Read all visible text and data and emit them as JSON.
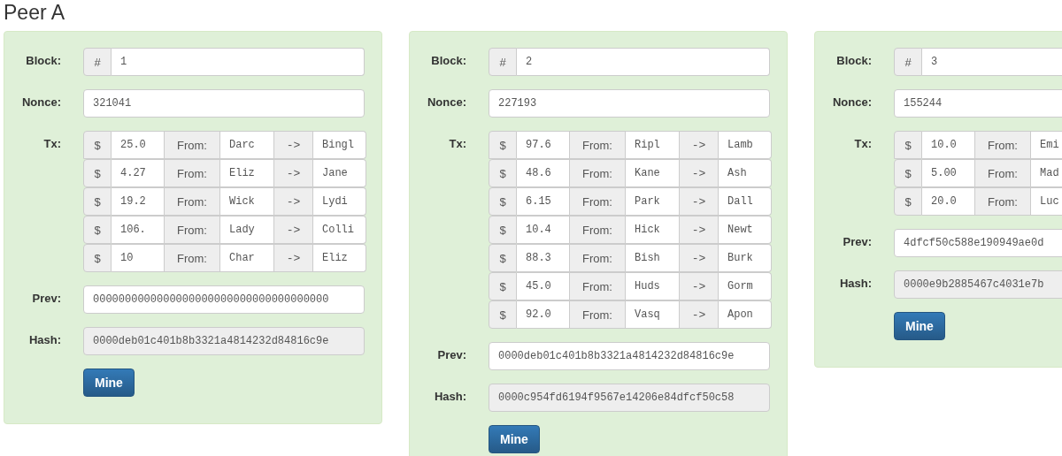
{
  "peer": {
    "title": "Peer A"
  },
  "blocks": [
    {
      "block_label": "Block:",
      "block_prefix": "#",
      "number": "1",
      "nonce_label": "Nonce:",
      "nonce": "321041",
      "tx_label": "Tx:",
      "transactions": [
        {
          "currency": "$",
          "amount": "25.0",
          "from_label": "From:",
          "from": "Darc",
          "arrow": "->",
          "to": "Bingl"
        },
        {
          "currency": "$",
          "amount": "4.27",
          "from_label": "From:",
          "from": "Eliz",
          "arrow": "->",
          "to": "Jane"
        },
        {
          "currency": "$",
          "amount": "19.2",
          "from_label": "From:",
          "from": "Wick",
          "arrow": "->",
          "to": "Lydi"
        },
        {
          "currency": "$",
          "amount": "106.",
          "from_label": "From:",
          "from": "Lady",
          "arrow": "->",
          "to": "Colli"
        },
        {
          "currency": "$",
          "amount": "10",
          "from_label": "From:",
          "from": "Char",
          "arrow": "->",
          "to": "Eliz"
        }
      ],
      "prev_label": "Prev:",
      "prev": "0000000000000000000000000000000000000",
      "hash_label": "Hash:",
      "hash": "0000deb01c401b8b3321a4814232d84816c9e",
      "hash_readonly": true,
      "mine_button": "Mine"
    },
    {
      "block_label": "Block:",
      "block_prefix": "#",
      "number": "2",
      "nonce_label": "Nonce:",
      "nonce": "227193",
      "tx_label": "Tx:",
      "transactions": [
        {
          "currency": "$",
          "amount": "97.6",
          "from_label": "From:",
          "from": "Ripl",
          "arrow": "->",
          "to": "Lamb"
        },
        {
          "currency": "$",
          "amount": "48.6",
          "from_label": "From:",
          "from": "Kane",
          "arrow": "->",
          "to": "Ash"
        },
        {
          "currency": "$",
          "amount": "6.15",
          "from_label": "From:",
          "from": "Park",
          "arrow": "->",
          "to": "Dall"
        },
        {
          "currency": "$",
          "amount": "10.4",
          "from_label": "From:",
          "from": "Hick",
          "arrow": "->",
          "to": "Newt"
        },
        {
          "currency": "$",
          "amount": "88.3",
          "from_label": "From:",
          "from": "Bish",
          "arrow": "->",
          "to": "Burk"
        },
        {
          "currency": "$",
          "amount": "45.0",
          "from_label": "From:",
          "from": "Huds",
          "arrow": "->",
          "to": "Gorm"
        },
        {
          "currency": "$",
          "amount": "92.0",
          "from_label": "From:",
          "from": "Vasq",
          "arrow": "->",
          "to": "Apon"
        }
      ],
      "prev_label": "Prev:",
      "prev": "0000deb01c401b8b3321a4814232d84816c9e",
      "hash_label": "Hash:",
      "hash": "0000c954fd6194f9567e14206e84dfcf50c58",
      "hash_readonly": true,
      "mine_button": "Mine"
    },
    {
      "block_label": "Block:",
      "block_prefix": "#",
      "number": "3",
      "nonce_label": "Nonce:",
      "nonce": "155244",
      "tx_label": "Tx:",
      "transactions": [
        {
          "currency": "$",
          "amount": "10.0",
          "from_label": "From:",
          "from": "Emi"
        },
        {
          "currency": "$",
          "amount": "5.00",
          "from_label": "From:",
          "from": "Mad"
        },
        {
          "currency": "$",
          "amount": "20.0",
          "from_label": "From:",
          "from": "Luc"
        }
      ],
      "prev_label": "Prev:",
      "prev": "4dfcf50c588e190949ae0d",
      "hash_label": "Hash:",
      "hash": "0000e9b2885467c4031e7b",
      "hash_readonly": true,
      "mine_button": "Mine"
    }
  ]
}
